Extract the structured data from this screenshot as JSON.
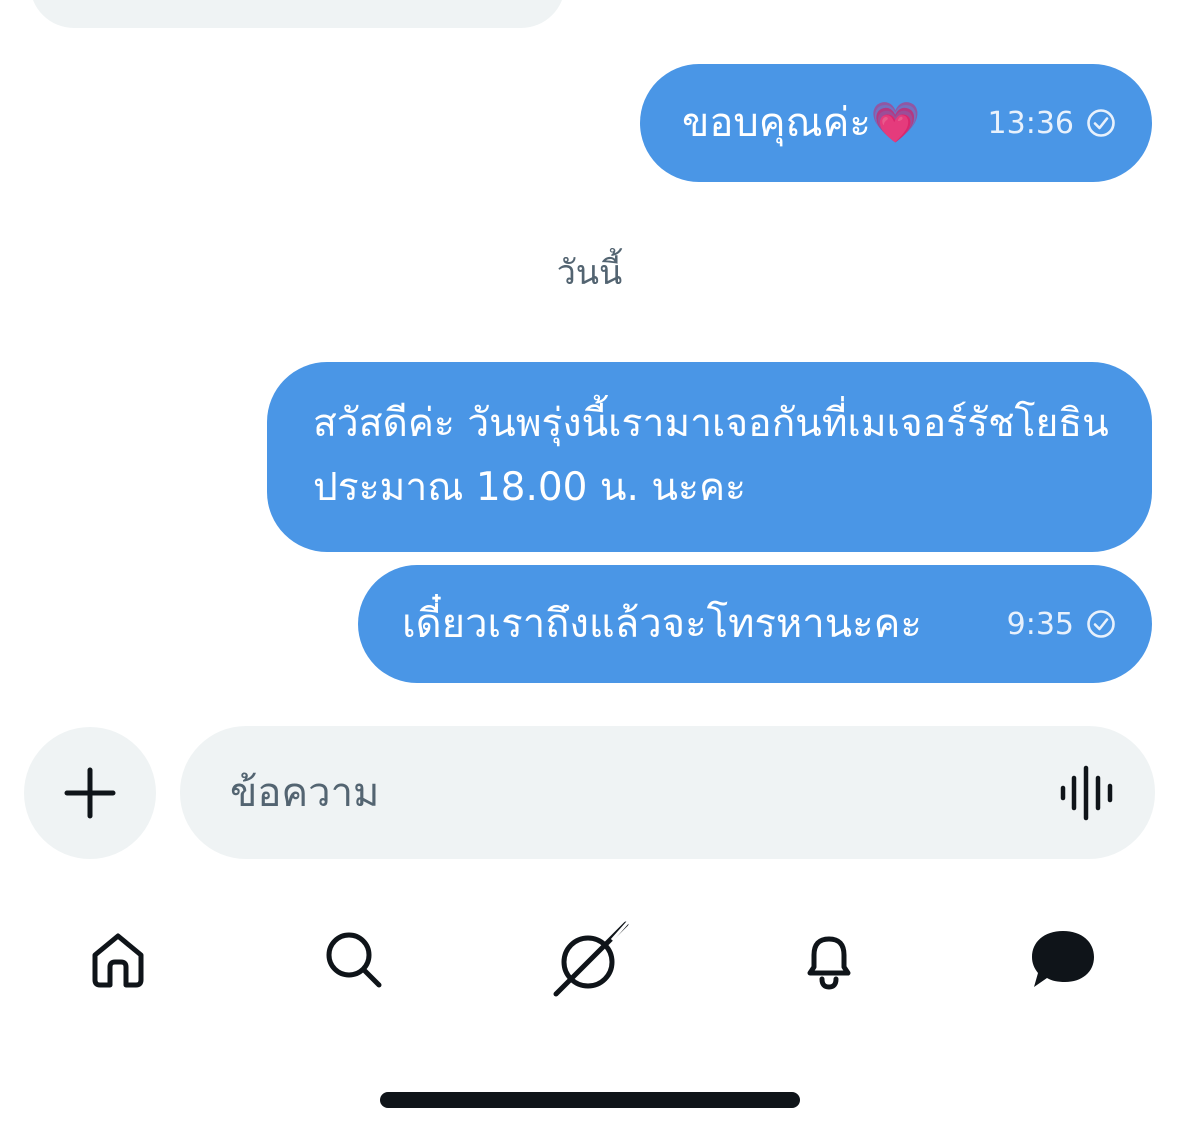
{
  "conversation": {
    "messages_before": [
      {
        "text": "ขอบคุณค่ะ💗",
        "time": "13:36"
      }
    ],
    "date_separator": "วันนี้",
    "messages_today": [
      {
        "text": "สวัสดีค่ะ วันพรุ่งนี้เรามาเจอกันที่เมเจอร์รัชโยธิน ประมาณ 18.00 น. นะคะ"
      },
      {
        "text": "เดี๋ยวเราถึงแล้วจะโทรหานะคะ",
        "time": "9:35"
      }
    ]
  },
  "composer": {
    "placeholder": "ข้อความ",
    "add_icon": "plus-icon",
    "voice_icon": "voice-waveform-icon"
  },
  "tabs": [
    {
      "icon": "home-icon"
    },
    {
      "icon": "search-icon"
    },
    {
      "icon": "grok-icon"
    },
    {
      "icon": "bell-icon"
    },
    {
      "icon": "messages-icon",
      "active": true
    }
  ],
  "colors": {
    "outgoing_bubble": "#4a96e6",
    "incoming_bubble": "#eff3f4",
    "secondary_text": "#536471",
    "icon": "#0f1419"
  }
}
